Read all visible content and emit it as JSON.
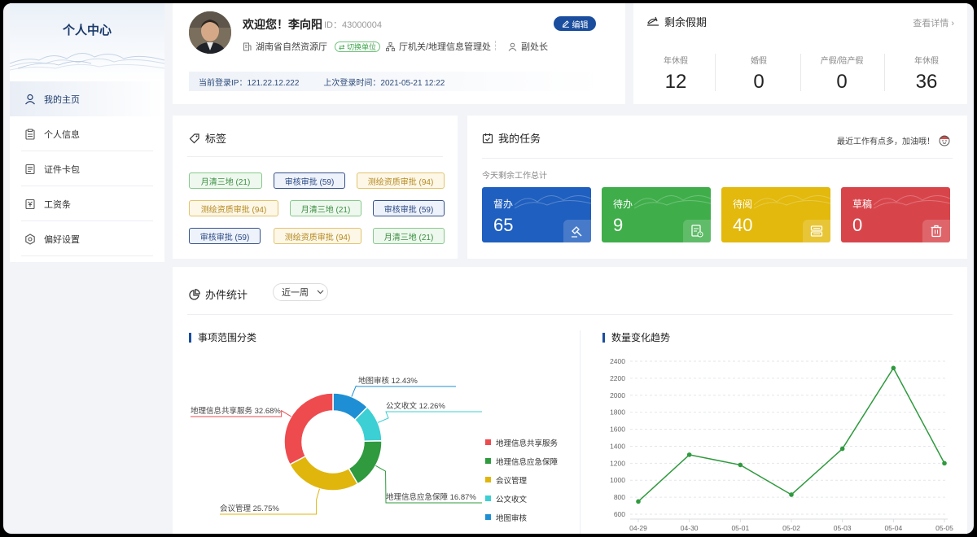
{
  "sidebar": {
    "title": "个人中心",
    "items": [
      {
        "label": "我的主页",
        "icon": "user-icon"
      },
      {
        "label": "个人信息",
        "icon": "clipboard-icon"
      },
      {
        "label": "证件卡包",
        "icon": "id-card-icon"
      },
      {
        "label": "工资条",
        "icon": "payslip-icon"
      },
      {
        "label": "偏好设置",
        "icon": "gear-icon"
      }
    ]
  },
  "profile": {
    "welcome": "欢迎您！李向阳",
    "id": "ID：43000004",
    "edit_label": "编辑",
    "org": "湖南省自然资源厅",
    "switch_label": "切换单位",
    "dept": "厅机关/地理信息管理处",
    "position": "副处长",
    "login_ip": "当前登录IP：121.22.12.222",
    "last_login": "上次登录时间：2021-05-21 12:22"
  },
  "leave": {
    "title": "剩余假期",
    "more": "查看详情",
    "items": [
      {
        "label": "年休假",
        "value": "12"
      },
      {
        "label": "婚假",
        "value": "0"
      },
      {
        "label": "产假/陪产假",
        "value": "0"
      },
      {
        "label": "年休假",
        "value": "36"
      }
    ]
  },
  "tags": {
    "title": "标签",
    "items": [
      {
        "label": "月清三地 (21)",
        "color": "green"
      },
      {
        "label": "审核审批 (59)",
        "color": "blue"
      },
      {
        "label": "测绘资质审批 (94)",
        "color": "yellow"
      },
      {
        "label": "测绘资质审批 (94)",
        "color": "yellow"
      },
      {
        "label": "月清三地 (21)",
        "color": "green"
      },
      {
        "label": "审核审批 (59)",
        "color": "blue"
      },
      {
        "label": "审核审批 (59)",
        "color": "blue"
      },
      {
        "label": "测绘资质审批 (94)",
        "color": "yellow"
      },
      {
        "label": "月清三地 (21)",
        "color": "green"
      }
    ]
  },
  "tasks": {
    "title": "我的任务",
    "note": "最近工作有点多，加油哦！",
    "subtitle": "今天剩余工作总计",
    "cards": [
      {
        "label": "督办",
        "value": "65",
        "color": "#1f5fbf",
        "icon": "gavel-icon"
      },
      {
        "label": "待办",
        "value": "9",
        "color": "#3fae4a",
        "icon": "todo-doc-icon"
      },
      {
        "label": "待阅",
        "value": "40",
        "color": "#e2b90c",
        "icon": "reading-icon"
      },
      {
        "label": "草稿",
        "value": "0",
        "color": "#d7454b",
        "icon": "trash-icon"
      }
    ]
  },
  "stats": {
    "title": "办件统计",
    "range": "近一周",
    "pie_title": "事项范围分类",
    "line_title": "数量变化趋势"
  },
  "chart_data": [
    {
      "type": "pie",
      "title": "事项范围分类",
      "donut": true,
      "categories": [
        "地理信息共享服务",
        "地理信息应急保障",
        "会议管理",
        "公文收文",
        "地图审核"
      ],
      "values": [
        32.68,
        16.87,
        25.75,
        12.26,
        12.43
      ],
      "labels": [
        "地理信息共享服务  32.68%",
        "地理信息应急保障  16.87%",
        "会议管理  25.75%",
        "公文收文  12.26%",
        "地图审核  12.43%"
      ],
      "colors": [
        "#ee4b4f",
        "#2f9a3e",
        "#e0b60d",
        "#3ccfd3",
        "#1e8fd4"
      ],
      "legend": "right"
    },
    {
      "type": "line",
      "title": "数量变化趋势",
      "x": [
        "04-29",
        "04-30",
        "05-01",
        "05-02",
        "05-03",
        "05-04",
        "05-05"
      ],
      "series": [
        {
          "values": [
            750,
            1300,
            1180,
            830,
            1370,
            2320,
            1200
          ]
        }
      ],
      "yticks": [
        600,
        800,
        1000,
        1200,
        1400,
        1600,
        1800,
        2000,
        2200,
        2400
      ],
      "ylim": [
        600,
        2400
      ],
      "grid": true,
      "color": "#2f9a3e"
    }
  ]
}
